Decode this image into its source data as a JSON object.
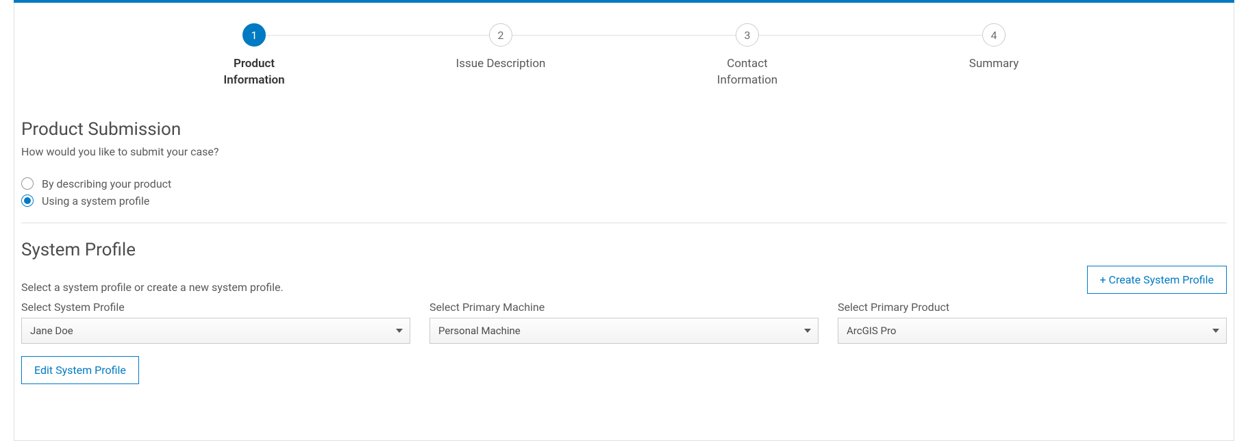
{
  "stepper": {
    "steps": [
      {
        "num": "1",
        "label": "Product\nInformation",
        "active": true
      },
      {
        "num": "2",
        "label": "Issue Description",
        "active": false
      },
      {
        "num": "3",
        "label": "Contact\nInformation",
        "active": false
      },
      {
        "num": "4",
        "label": "Summary",
        "active": false
      }
    ]
  },
  "product_submission": {
    "title": "Product Submission",
    "question": "How would you like to submit your case?",
    "options": {
      "describe": "By describing your product",
      "profile": "Using a system profile"
    },
    "selected": "profile"
  },
  "system_profile": {
    "title": "System Profile",
    "subtitle": "Select a system profile or create a new system profile.",
    "create_button": "+ Create System Profile",
    "edit_button": "Edit System Profile",
    "selects": {
      "profile": {
        "label": "Select System Profile",
        "value": "Jane Doe"
      },
      "machine": {
        "label": "Select Primary Machine",
        "value": "Personal Machine"
      },
      "product": {
        "label": "Select Primary Product",
        "value": "ArcGIS Pro"
      }
    }
  }
}
